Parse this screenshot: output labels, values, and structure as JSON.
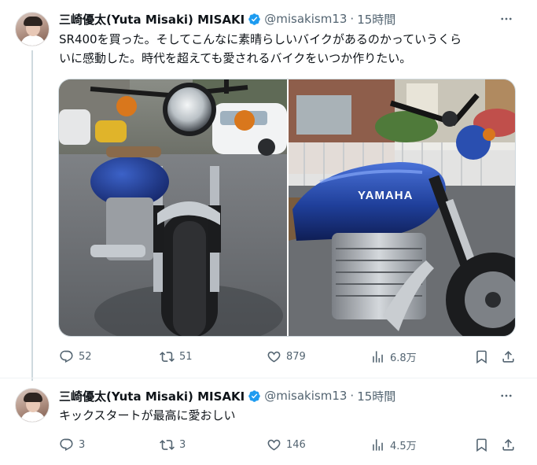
{
  "tweets": [
    {
      "author_name": "三崎優太(Yuta Misaki) MISAKI",
      "handle": "@misakism13",
      "separator": "·",
      "time": "15時間",
      "text_line1": "SR400を買った。そしてこんなに素晴らしいバイクがあるのかっていうくら",
      "text_line2": "いに感動した。時代を超えても愛されるバイクをいつか作りたい。",
      "media": {
        "left_alt": "Motorcycle front view",
        "right_alt": "Motorcycle side view",
        "tank_logo": "YAMAHA"
      },
      "stats": {
        "replies": "52",
        "retweets": "51",
        "likes": "879",
        "views": "6.8万"
      }
    },
    {
      "author_name": "三崎優太(Yuta Misaki) MISAKI",
      "handle": "@misakism13",
      "separator": "·",
      "time": "15時間",
      "text_line1": "キックスタートが最高に愛おしい",
      "stats": {
        "replies": "3",
        "retweets": "3",
        "likes": "146",
        "views": "4.5万"
      }
    }
  ],
  "colors": {
    "verified_badge": "#1d9bf0",
    "text_primary": "#0f1419",
    "text_secondary": "#536471",
    "tank_blue": "#1f3f9a"
  },
  "icons": [
    "more-icon",
    "verified-icon",
    "reply-icon",
    "retweet-icon",
    "like-icon",
    "views-icon",
    "bookmark-icon",
    "share-icon"
  ]
}
